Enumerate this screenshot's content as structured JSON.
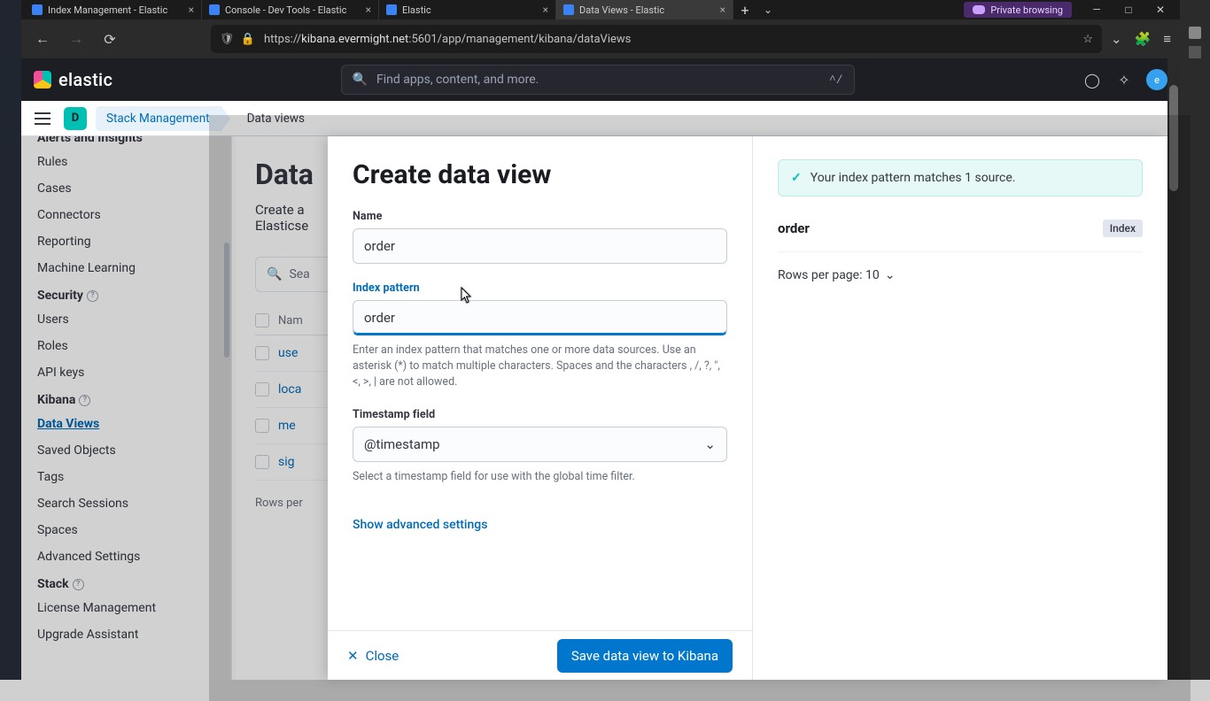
{
  "browser": {
    "tabs": [
      {
        "label": "Index Management - Elastic"
      },
      {
        "label": "Console - Dev Tools - Elastic"
      },
      {
        "label": "Elastic"
      },
      {
        "label": "Data Views - Elastic",
        "active": true
      }
    ],
    "private_label": "Private browsing",
    "url_prefix": "https://",
    "url_host": "kibana.evermight.net",
    "url_path": ":5601/app/management/kibana/dataViews"
  },
  "header": {
    "brand": "elastic",
    "search_placeholder": "Find apps, content, and more.",
    "search_kbd": "^/",
    "avatar": "e"
  },
  "breadcrumbs": {
    "space": "D",
    "a": "Stack Management",
    "b": "Data views"
  },
  "sidebar": {
    "cutoff_heading": "Alerts and Insights",
    "group1": [
      "Rules",
      "Cases",
      "Connectors",
      "Reporting",
      "Machine Learning"
    ],
    "heading2": "Security",
    "group2": [
      "Users",
      "Roles",
      "API keys"
    ],
    "heading3": "Kibana",
    "group3": [
      "Data Views",
      "Saved Objects",
      "Tags",
      "Search Sessions",
      "Spaces",
      "Advanced Settings"
    ],
    "heading4": "Stack",
    "group4": [
      "License Management",
      "Upgrade Assistant"
    ]
  },
  "main_under": {
    "title": "Data",
    "subtitle1": "Create a",
    "subtitle2": "Elasticse",
    "search_placeholder": "Sea",
    "col_name": "Nam",
    "rows": [
      "use",
      "loca",
      "me",
      "sig"
    ],
    "rows_per": "Rows per"
  },
  "flyout": {
    "title": "Create data view",
    "name_label": "Name",
    "name_value": "order",
    "pattern_label": "Index pattern",
    "pattern_value": "order",
    "pattern_help": "Enter an index pattern that matches one or more data sources. Use an asterisk (*) to match multiple characters. Spaces and the characters , /, ?, \", <, >, | are not allowed.",
    "ts_label": "Timestamp field",
    "ts_value": "@timestamp",
    "ts_help": "Select a timestamp field for use with the global time filter.",
    "advanced": "Show advanced settings",
    "close": "Close",
    "save": "Save data view to Kibana",
    "callout": "Your index pattern matches 1 source.",
    "match_name": "order",
    "match_badge": "Index",
    "rpp": "Rows per page: 10"
  }
}
